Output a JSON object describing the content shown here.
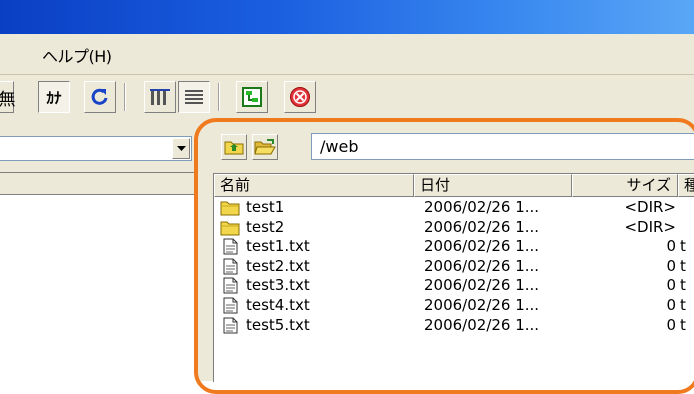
{
  "menu": {
    "help": "ヘルプ(H)"
  },
  "toolbar": {
    "kana_label": "ｶﾅ",
    "partial_glyph": "無"
  },
  "path": {
    "value": "/web"
  },
  "columns": {
    "name": "名前",
    "date": "日付",
    "size": "サイズ",
    "type": "種"
  },
  "files": [
    {
      "name": "test1",
      "kind": "folder",
      "date": "2006/02/26 1...",
      "size": "<DIR>",
      "type": ""
    },
    {
      "name": "test2",
      "kind": "folder",
      "date": "2006/02/26 1...",
      "size": "<DIR>",
      "type": ""
    },
    {
      "name": "test1.txt",
      "kind": "file",
      "date": "2006/02/26 1...",
      "size": "0",
      "type": "t"
    },
    {
      "name": "test2.txt",
      "kind": "file",
      "date": "2006/02/26 1...",
      "size": "0",
      "type": "t"
    },
    {
      "name": "test3.txt",
      "kind": "file",
      "date": "2006/02/26 1...",
      "size": "0",
      "type": "t"
    },
    {
      "name": "test4.txt",
      "kind": "file",
      "date": "2006/02/26 1...",
      "size": "0",
      "type": "t"
    },
    {
      "name": "test5.txt",
      "kind": "file",
      "date": "2006/02/26 1...",
      "size": "0",
      "type": "t"
    }
  ],
  "colors": {
    "highlight": "#f07a1e",
    "titlebar": "#1b5fe0",
    "chrome": "#ece9d8",
    "folder": "#f2d64b"
  }
}
